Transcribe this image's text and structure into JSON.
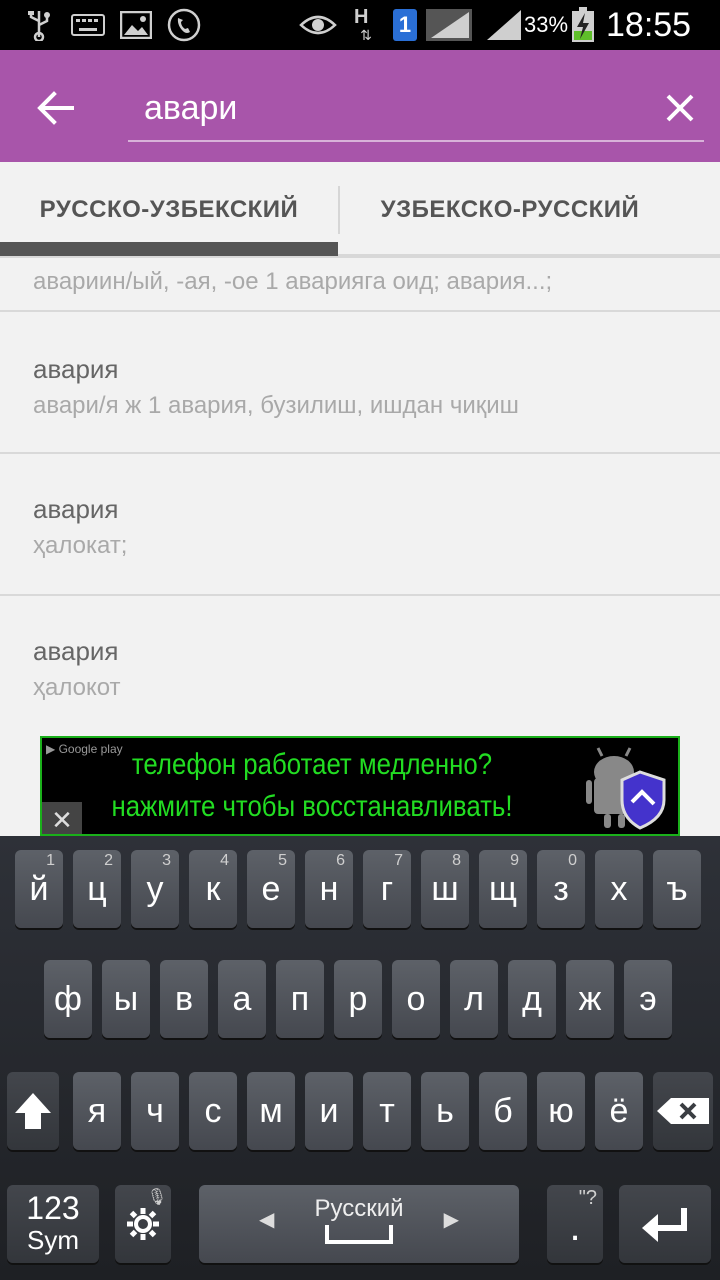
{
  "status_bar": {
    "battery": "33%",
    "time": "18:55",
    "network_h": "H",
    "sim_slot": "1"
  },
  "app_bar": {
    "search_value": "авари"
  },
  "tabs": [
    {
      "label": "РУССКО-УЗБЕКСКИЙ",
      "selected": true
    },
    {
      "label": "УЗБЕКСКО-РУССКИЙ",
      "selected": false
    }
  ],
  "results": [
    {
      "word": "",
      "translation": "авариин/ый, -ая, -ое 1 аварияга оид; авария...;"
    },
    {
      "word": "авария",
      "translation": "авари/я ж 1 авария, бузилиш, ишдан чиқиш"
    },
    {
      "word": "авария",
      "translation": "ҳалокат;"
    },
    {
      "word": "авария",
      "translation": "ҳалокот"
    }
  ],
  "ad": {
    "line1": "телефон работает медленно?",
    "line2": "нажмите чтобы восстанавливать!",
    "store_label": "Google play",
    "close": "✕"
  },
  "keyboard": {
    "row1": [
      {
        "char": "й",
        "hint": "1"
      },
      {
        "char": "ц",
        "hint": "2"
      },
      {
        "char": "у",
        "hint": "3"
      },
      {
        "char": "к",
        "hint": "4"
      },
      {
        "char": "е",
        "hint": "5"
      },
      {
        "char": "н",
        "hint": "6"
      },
      {
        "char": "г",
        "hint": "7"
      },
      {
        "char": "ш",
        "hint": "8"
      },
      {
        "char": "щ",
        "hint": "9"
      },
      {
        "char": "з",
        "hint": "0"
      },
      {
        "char": "х",
        "hint": ""
      },
      {
        "char": "ъ",
        "hint": ""
      }
    ],
    "row2": [
      "ф",
      "ы",
      "в",
      "а",
      "п",
      "р",
      "о",
      "л",
      "д",
      "ж",
      "э"
    ],
    "row3": [
      "я",
      "ч",
      "с",
      "м",
      "и",
      "т",
      "ь",
      "б",
      "ю",
      "ё"
    ],
    "sym_top": "123",
    "sym_bottom": "Sym",
    "space_label": "Русский",
    "period": ".",
    "period_hint": "\"?"
  }
}
